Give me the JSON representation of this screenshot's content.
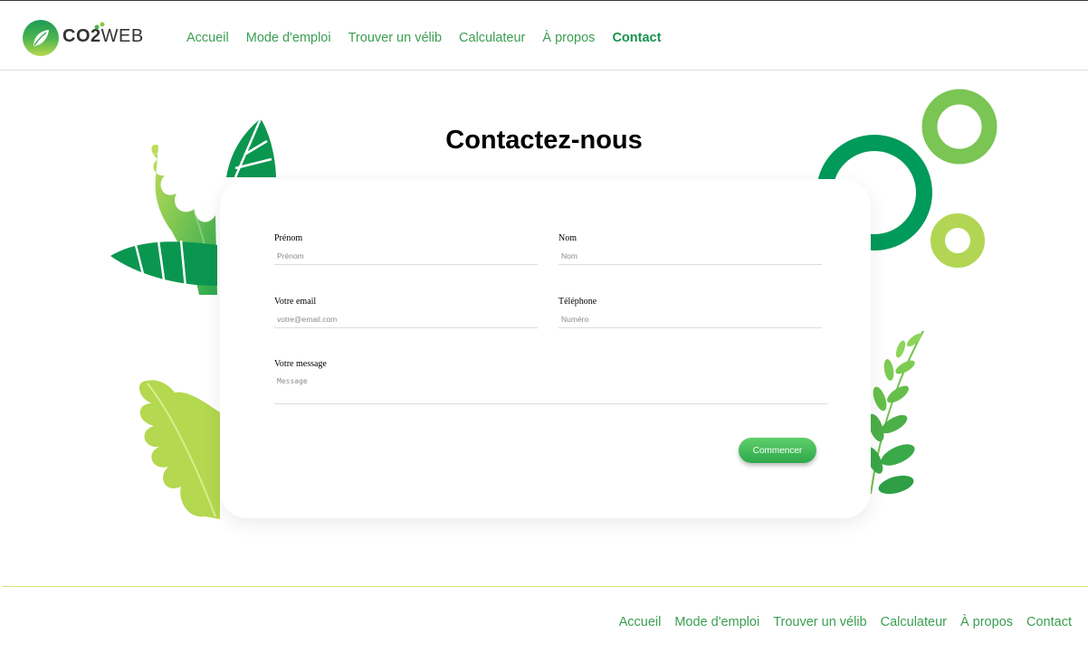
{
  "brand": {
    "name_bold": "CO2",
    "name_light": "WEB"
  },
  "nav": {
    "items": [
      {
        "label": "Accueil"
      },
      {
        "label": "Mode d'emploi"
      },
      {
        "label": "Trouver un vélib"
      },
      {
        "label": "Calculateur"
      },
      {
        "label": "À propos"
      },
      {
        "label": "Contact",
        "active": true
      }
    ]
  },
  "page_title": "Contactez-nous",
  "form": {
    "first_name": {
      "label": "Prénom",
      "placeholder": "Prénom",
      "value": ""
    },
    "last_name": {
      "label": "Nom",
      "placeholder": "Nom",
      "value": ""
    },
    "email": {
      "label": "Votre email",
      "placeholder": "votre@email.com",
      "value": ""
    },
    "phone": {
      "label": "Téléphone",
      "placeholder": "Numéro",
      "value": ""
    },
    "message": {
      "label": "Votre message",
      "placeholder": "Message",
      "value": ""
    },
    "submit_label": "Commencer"
  },
  "footer": {
    "nav": [
      {
        "label": "Accueil"
      },
      {
        "label": "Mode d'emploi"
      },
      {
        "label": "Trouver un vélib"
      },
      {
        "label": "Calculateur"
      },
      {
        "label": "À propos"
      },
      {
        "label": "Contact"
      }
    ]
  },
  "colors": {
    "brand_green": "#16924c",
    "link_green": "#3b9e52",
    "dark_green": "#009a5a",
    "mid_green": "#7ac554",
    "light_green": "#b2d654"
  }
}
